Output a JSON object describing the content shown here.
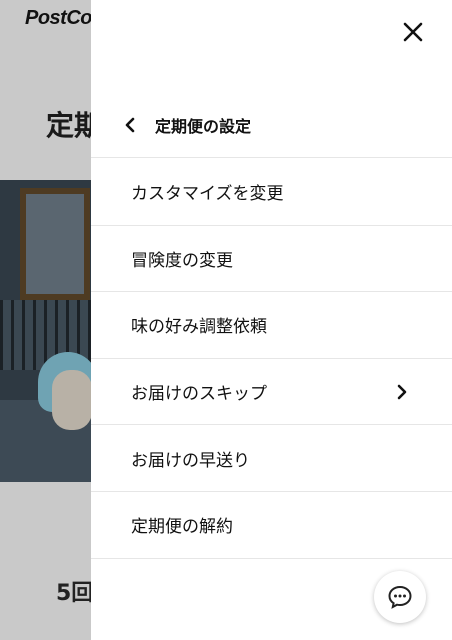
{
  "background": {
    "logo": "PostCo",
    "title": "定期",
    "bottom_text": "5回"
  },
  "drawer": {
    "header_title": "定期便の設定",
    "back_icon": "chevron-left-icon",
    "close_icon": "close-icon",
    "items": [
      {
        "label": "カスタマイズを変更",
        "has_submenu": false
      },
      {
        "label": "冒険度の変更",
        "has_submenu": false
      },
      {
        "label": "味の好み調整依頼",
        "has_submenu": false
      },
      {
        "label": "お届けのスキップ",
        "has_submenu": true
      },
      {
        "label": "お届けの早送り",
        "has_submenu": false
      },
      {
        "label": "定期便の解約",
        "has_submenu": false
      }
    ]
  },
  "chat": {
    "icon": "chat-bubble-icon"
  },
  "colors": {
    "overlay": "#c9c9c9",
    "drawer_bg": "#ffffff",
    "divider": "#e6e6e6",
    "text": "#111111"
  }
}
